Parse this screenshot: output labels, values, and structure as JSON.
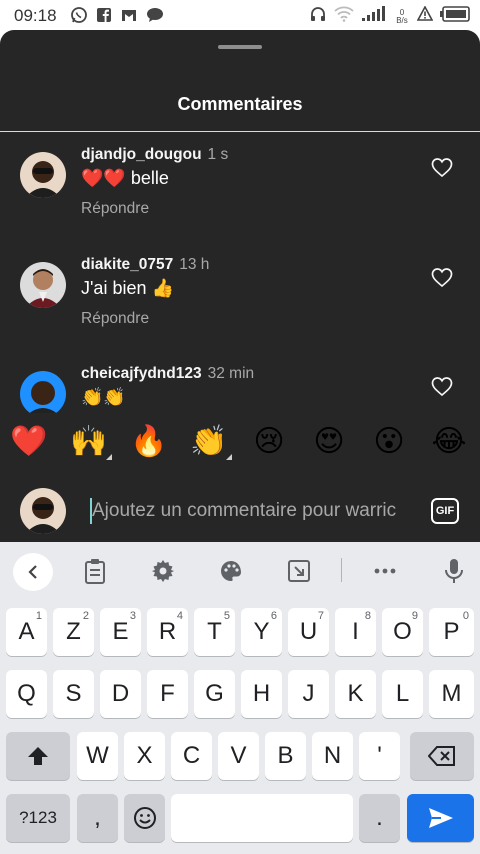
{
  "status_bar": {
    "time": "09:18",
    "left_icons": [
      "whatsapp-icon",
      "facebook-icon",
      "gmail-icon",
      "chat-bubble-icon"
    ],
    "right_icons": [
      "headphones-icon",
      "wifi-icon",
      "signal-icon",
      "data-speed-icon",
      "alert-icon",
      "battery-icon"
    ],
    "speed_value": "0",
    "speed_unit": "B/s"
  },
  "sheet": {
    "title": "Commentaires"
  },
  "comments": [
    {
      "username": "djandjo_dougou",
      "time": "1 s",
      "text": "❤️❤️ belle",
      "reply_label": "Répondre"
    },
    {
      "username": "diakite_0757",
      "time": "13 h",
      "text": "J'ai bien 👍",
      "reply_label": "Répondre"
    },
    {
      "username": "cheicajfydnd123",
      "time": "32 min",
      "text": "👏👏",
      "reply_label": ""
    }
  ],
  "emoji_bar": [
    "❤️",
    "🙌",
    "🔥",
    "👏",
    "😢",
    "😍",
    "😮",
    "😂"
  ],
  "comment_input": {
    "placeholder": "Ajoutez un commentaire pour warric",
    "gif_label": "GIF"
  },
  "keyboard": {
    "toolbar_icons": [
      "back-chevron-icon",
      "clipboard-icon",
      "settings-icon",
      "palette-icon",
      "resize-icon",
      "more-icon",
      "microphone-icon"
    ],
    "row1": [
      {
        "label": "A",
        "hint": "1"
      },
      {
        "label": "Z",
        "hint": "2"
      },
      {
        "label": "E",
        "hint": "3"
      },
      {
        "label": "R",
        "hint": "4"
      },
      {
        "label": "T",
        "hint": "5"
      },
      {
        "label": "Y",
        "hint": "6"
      },
      {
        "label": "U",
        "hint": "7"
      },
      {
        "label": "I",
        "hint": "8"
      },
      {
        "label": "O",
        "hint": "9"
      },
      {
        "label": "P",
        "hint": "0"
      }
    ],
    "row2": [
      "Q",
      "S",
      "D",
      "F",
      "G",
      "H",
      "J",
      "K",
      "L",
      "M"
    ],
    "row3": [
      "W",
      "X",
      "C",
      "V",
      "B",
      "N",
      "'"
    ],
    "symbols_label": "?123",
    "comma_label": ",",
    "period_label": "."
  },
  "colors": {
    "sheet_bg": "#262626",
    "keyboard_bg": "#e8eaed",
    "send_blue": "#1a73e8",
    "heart_red": "#e0245e"
  }
}
